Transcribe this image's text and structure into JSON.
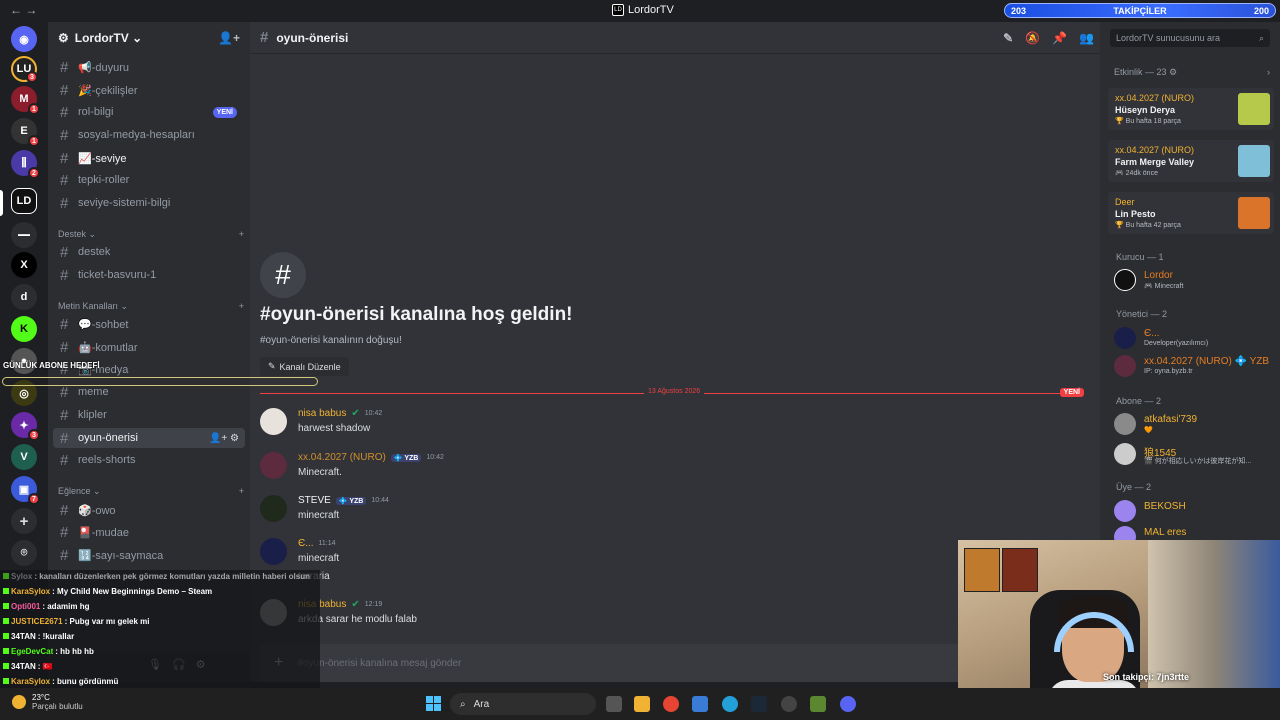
{
  "window": {
    "title": "LordorTV",
    "nav": "← →"
  },
  "follow_goal": {
    "current": "203",
    "label": "TAKİPÇİLER",
    "target": "200"
  },
  "server_badges": [
    "3",
    "1",
    "1",
    "2",
    "3",
    "7"
  ],
  "server_letter": "d",
  "guild": {
    "name": "LordorTV ⌄"
  },
  "channels_top": [
    {
      "label": "📢-duyuru"
    },
    {
      "label": "🎉-çekilişler"
    },
    {
      "label": "rol-bilgi",
      "badge": "YENİ"
    },
    {
      "label": "sosyal-medya-hesapları"
    },
    {
      "label": "📈-seviye"
    },
    {
      "label": "tepki-roller"
    },
    {
      "label": "seviye-sistemi-bilgi"
    }
  ],
  "categories": {
    "destek": "Destek ⌄",
    "metin": "Metin Kanalları ⌄",
    "eglence": "Eğlence ⌄"
  },
  "channels_destek": [
    {
      "label": "destek"
    },
    {
      "label": "ticket-basvuru-1"
    }
  ],
  "channels_metin": [
    {
      "label": "💬-sohbet"
    },
    {
      "label": "🤖-komutlar"
    },
    {
      "label": "📷-medya"
    },
    {
      "label": "meme"
    },
    {
      "label": "klipler"
    },
    {
      "label": "oyun-önerisi"
    },
    {
      "label": "reels-shorts"
    }
  ],
  "channels_eglence": [
    {
      "label": "🎲-owo"
    },
    {
      "label": "🎴-mudae"
    },
    {
      "label": "🔢-sayı-saymaca"
    }
  ],
  "header": {
    "channel": "oyun-önerisi"
  },
  "welcome": {
    "title": "#oyun-önerisi kanalına hoş geldin!",
    "subtitle": "#oyun-önerisi kanalının doğuşu!",
    "edit": "Kanalı Düzenle"
  },
  "divider": {
    "date": "13 Ağustos 2026",
    "tag": "YENİ"
  },
  "messages": [
    {
      "author": "nisa babus",
      "color": "#f0b232",
      "time": "10:42",
      "lines": [
        "harwest  shadow"
      ]
    },
    {
      "author": "xx.04.2027 (NURO)",
      "color": "#d18f2c",
      "tag": "YZB",
      "time": "10:42",
      "lines": [
        "Minecraft."
      ]
    },
    {
      "author": "STEVE",
      "color": "#f2f3f5",
      "tag": "YZB",
      "time": "10:44",
      "lines": [
        "minecraft"
      ]
    },
    {
      "author": "Є...",
      "color": "#f0b232",
      "time": "11:14",
      "lines": [
        "minecraft",
        "terraria"
      ]
    },
    {
      "author": "nisa babus",
      "color": "#f0b232",
      "time": "12:19",
      "lines": [
        "arkda sarar he modlu falab"
      ]
    }
  ],
  "composer": {
    "placeholder": "#oyun-önerisi kanalına mesaj gönder"
  },
  "members": {
    "search_placeholder": "LordorTV sunucusunu ara",
    "events_header": "Etkinlik — 23 ⚙",
    "events": [
      {
        "top": "xx.04.2027 (NURO)",
        "name": "Hüseyn Derya",
        "sub": "🏆 Bu hafta 18 parça"
      },
      {
        "top": "xx.04.2027 (NURO)",
        "name": "Farm Merge Valley",
        "sub": "🎮 24dk önce"
      },
      {
        "top": "Deer",
        "name": "Lin Pesto",
        "sub": "🏆 Bu hafta 42 parça"
      }
    ],
    "groups": {
      "kurucu": "Kurucu — 1",
      "yonetici": "Yönetici — 2",
      "abone": "Abone — 2",
      "uye": "Üye — 2"
    },
    "people": [
      {
        "name": "Lordor",
        "status": "🎮 Minecraft",
        "color": "#e67e22"
      },
      {
        "name": "Є...",
        "status": "Developer(yazılımcı)",
        "color": "#e67e22"
      },
      {
        "name": "xx.04.2027 (NURO) 💠 YZB",
        "status": "IP: oyna.byzb.tr",
        "color": "#e67e22"
      },
      {
        "name": "atkafasi'739",
        "status": "🧡",
        "color": "#f0b232"
      },
      {
        "name": "狼1545",
        "status": "🎬 何が相応しいかは彼岸花が知...",
        "color": "#f0b232"
      },
      {
        "name": "BEKOSH",
        "status": "",
        "color": "#f0b232"
      },
      {
        "name": "MAL eres",
        "status": "",
        "color": "#f0b232"
      }
    ]
  },
  "overlay_goal": {
    "label": "GÜNLÜK ABONE HEDEFİ"
  },
  "chatlog": [
    {
      "user": "Sylox",
      "color": "#9aa0a6",
      "text": ": kanalları düzenlerken pek görmez komutları yazda milletin haberi olsun"
    },
    {
      "user": "KaraSylox",
      "color": "#f0b232",
      "text": ": My Child New Beginnings Demo – Steam"
    },
    {
      "user": "Opti001",
      "color": "#f75c9e",
      "text": ": adamim hg"
    },
    {
      "user": "JUSTICE2671",
      "color": "#f0b232",
      "text": ": Pubg var mı gelek mi"
    },
    {
      "user": "34TAN",
      "color": "#ffffff",
      "text": ": !kurallar"
    },
    {
      "user": "EgeDevCat",
      "color": "#53fc18",
      "text": ": hb hb hb"
    },
    {
      "user": "34TAN",
      "color": "#ffffff",
      "text": ": 🇹🇷"
    },
    {
      "user": "KaraSylox",
      "color": "#f0b232",
      "text": ": bunu gördünmü"
    }
  ],
  "webcam": {
    "label": "Son takipçi: 7jn3rtte"
  },
  "taskbar": {
    "temp": "23°C",
    "weather": "Parçalı bulutlu",
    "search": "Ara"
  }
}
